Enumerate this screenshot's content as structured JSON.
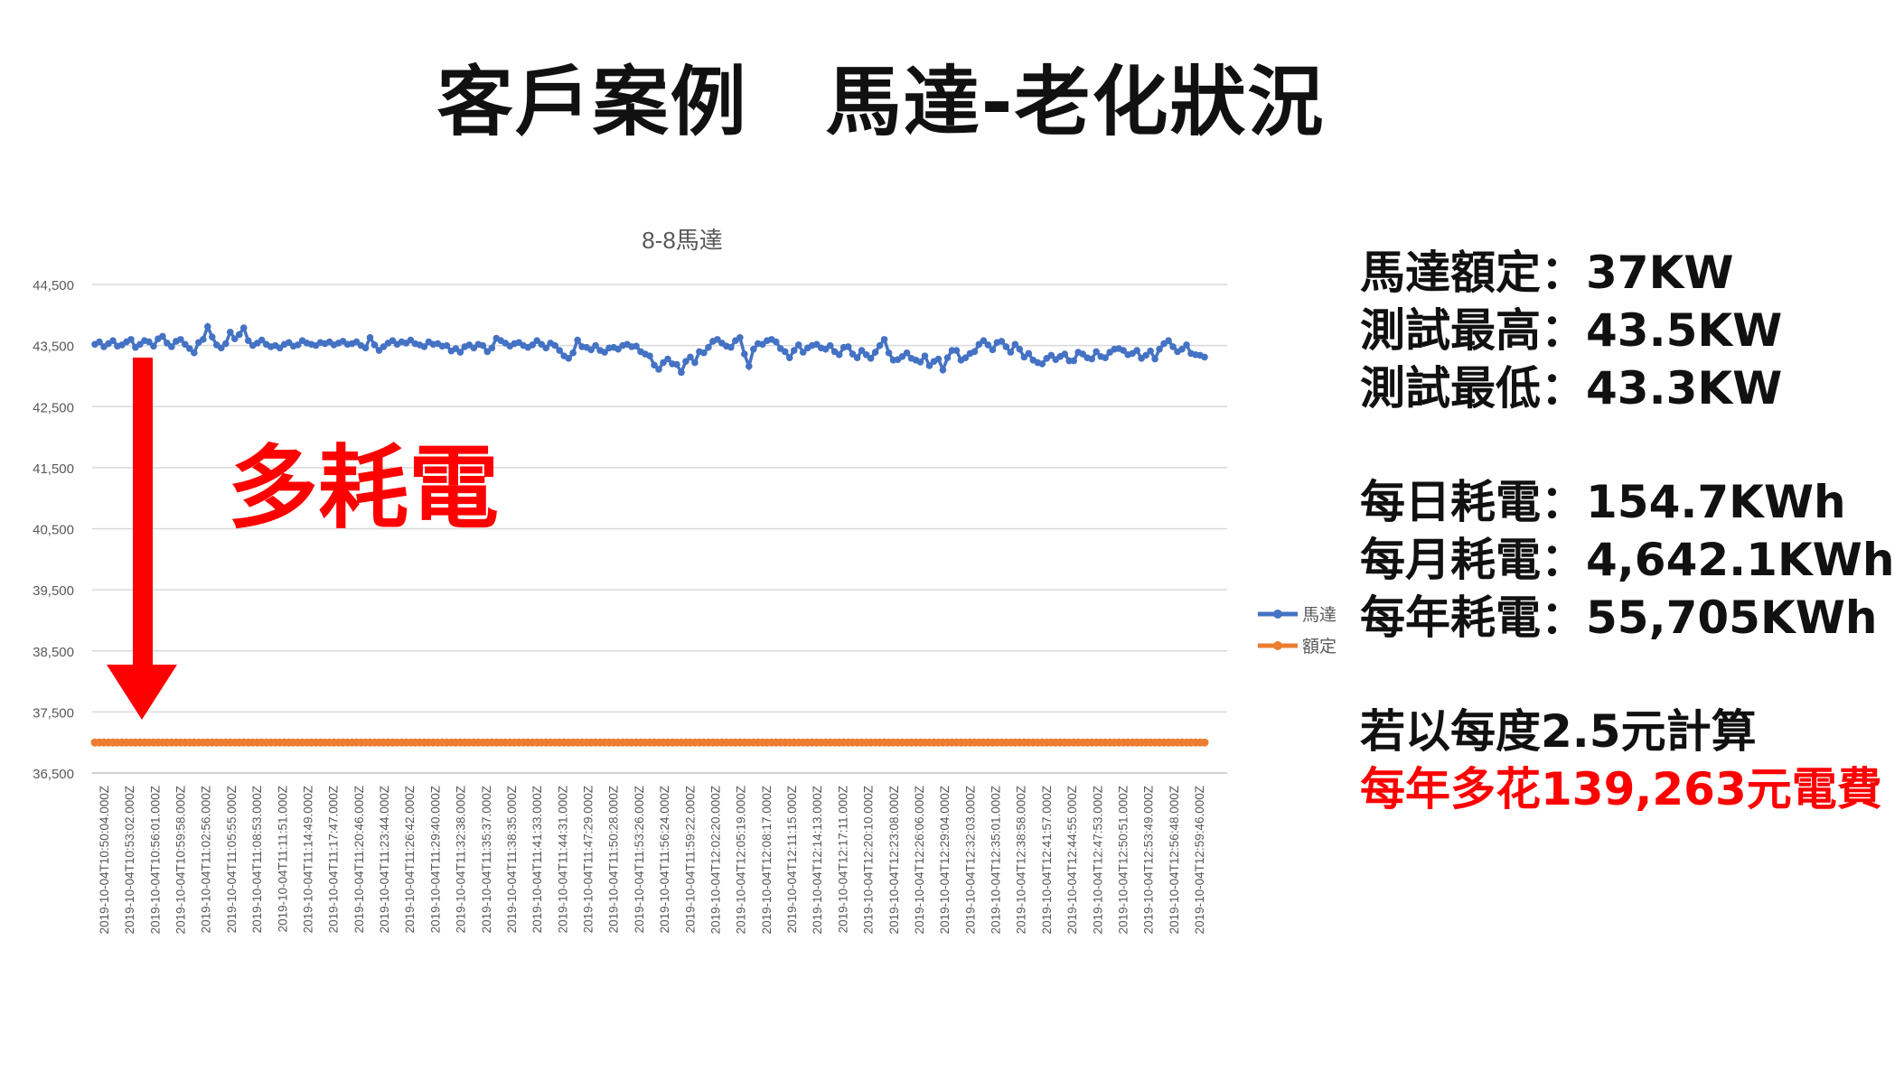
{
  "slide": {
    "title": "客戶案例　馬達-老化狀況",
    "annotation": "多耗電",
    "annotation_color": "#ff0000",
    "stats": {
      "rated": "馬達額定：37KW",
      "test_max": "測試最高：43.5KW",
      "test_min": "測試最低：43.3KW",
      "daily": "每日耗電：154.7KWh",
      "monthly": "每月耗電：4,642.1KWh",
      "yearly": "每年耗電：55,705KWh",
      "price_note": "若以每度2.5元計算",
      "extra_cost": "每年多花139,263元電費"
    }
  },
  "chart_data": {
    "type": "line",
    "title": "8-8馬達",
    "xlabel": "",
    "ylabel": "",
    "ylim": [
      36500,
      44500
    ],
    "yticks": [
      "44,500",
      "43,500",
      "42,500",
      "41,500",
      "40,500",
      "39,500",
      "38,500",
      "37,500",
      "36,500"
    ],
    "grid": true,
    "legend_position": "right",
    "x_tick_labels": [
      "2019-10-04T10:50:04.000Z",
      "2019-10-04T10:53:02.000Z",
      "2019-10-04T10:56:01.000Z",
      "2019-10-04T10:59:58.000Z",
      "2019-10-04T11:02:56.000Z",
      "2019-10-04T11:05:55.000Z",
      "2019-10-04T11:08:53.000Z",
      "2019-10-04T11:11:51.000Z",
      "2019-10-04T11:14:49.000Z",
      "2019-10-04T11:17:47.000Z",
      "2019-10-04T11:20:46.000Z",
      "2019-10-04T11:23:44.000Z",
      "2019-10-04T11:26:42.000Z",
      "2019-10-04T11:29:40.000Z",
      "2019-10-04T11:32:38.000Z",
      "2019-10-04T11:35:37.000Z",
      "2019-10-04T11:38:35.000Z",
      "2019-10-04T11:41:33.000Z",
      "2019-10-04T11:44:31.000Z",
      "2019-10-04T11:47:29.000Z",
      "2019-10-04T11:50:28.000Z",
      "2019-10-04T11:53:26.000Z",
      "2019-10-04T11:56:24.000Z",
      "2019-10-04T11:59:22.000Z",
      "2019-10-04T12:02:20.000Z",
      "2019-10-04T12:05:19.000Z",
      "2019-10-04T12:08:17.000Z",
      "2019-10-04T12:11:15.000Z",
      "2019-10-04T12:14:13.000Z",
      "2019-10-04T12:17:11.000Z",
      "2019-10-04T12:20:10.000Z",
      "2019-10-04T12:23:08.000Z",
      "2019-10-04T12:26:06.000Z",
      "2019-10-04T12:29:04.000Z",
      "2019-10-04T12:32:03.000Z",
      "2019-10-04T12:35:01.000Z",
      "2019-10-04T12:38:58.000Z",
      "2019-10-04T12:41:57.000Z",
      "2019-10-04T12:44:55.000Z",
      "2019-10-04T12:47:53.000Z",
      "2019-10-04T12:50:51.000Z",
      "2019-10-04T12:53:49.000Z",
      "2019-10-04T12:56:48.000Z",
      "2019-10-04T12:59:46.000Z"
    ],
    "series": [
      {
        "name": "馬達",
        "color": "#4472c4",
        "values": [
          43520,
          43560,
          43480,
          43530,
          43580,
          43490,
          43510,
          43560,
          43600,
          43470,
          43520,
          43580,
          43560,
          43490,
          43610,
          43650,
          43540,
          43480,
          43570,
          43600,
          43520,
          43450,
          43380,
          43550,
          43600,
          43810,
          43640,
          43510,
          43460,
          43530,
          43720,
          43610,
          43680,
          43790,
          43580,
          43500,
          43540,
          43590,
          43520,
          43480,
          43500,
          43460,
          43520,
          43550,
          43490,
          43510,
          43580,
          43540,
          43520,
          43500,
          43550,
          43530,
          43560,
          43510,
          43540,
          43570,
          43520,
          43530,
          43560,
          43500,
          43460,
          43630,
          43510,
          43420,
          43480,
          43540,
          43580,
          43520,
          43560,
          43540,
          43590,
          43530,
          43510,
          43480,
          43560,
          43520,
          43530,
          43490,
          43500,
          43410,
          43450,
          43390,
          43480,
          43510,
          43460,
          43520,
          43500,
          43400,
          43460,
          43620,
          43580,
          43540,
          43490,
          43530,
          43550,
          43500,
          43470,
          43510,
          43580,
          43520,
          43460,
          43540,
          43500,
          43420,
          43330,
          43290,
          43380,
          43590,
          43480,
          43470,
          43430,
          43500,
          43420,
          43390,
          43460,
          43470,
          43440,
          43500,
          43520,
          43480,
          43490,
          43400,
          43360,
          43330,
          43180,
          43110,
          43220,
          43280,
          43200,
          43190,
          43060,
          43240,
          43310,
          43220,
          43400,
          43380,
          43470,
          43570,
          43600,
          43540,
          43490,
          43470,
          43580,
          43630,
          43360,
          43160,
          43440,
          43530,
          43520,
          43580,
          43600,
          43560,
          43450,
          43400,
          43300,
          43420,
          43510,
          43390,
          43460,
          43500,
          43520,
          43460,
          43440,
          43500,
          43400,
          43350,
          43470,
          43480,
          43360,
          43300,
          43420,
          43350,
          43290,
          43390,
          43500,
          43600,
          43380,
          43260,
          43270,
          43320,
          43380,
          43290,
          43260,
          43230,
          43330,
          43170,
          43240,
          43280,
          43100,
          43300,
          43420,
          43420,
          43260,
          43300,
          43370,
          43400,
          43520,
          43580,
          43510,
          43430,
          43550,
          43570,
          43480,
          43390,
          43520,
          43440,
          43310,
          43370,
          43260,
          43220,
          43200,
          43290,
          43340,
          43270,
          43320,
          43360,
          43250,
          43250,
          43390,
          43360,
          43300,
          43280,
          43400,
          43320,
          43300,
          43390,
          43440,
          43450,
          43420,
          43350,
          43370,
          43420,
          43290,
          43340,
          43410,
          43280,
          43440,
          43530,
          43580,
          43480,
          43400,
          43440,
          43510,
          43370,
          43350,
          43340,
          43310
        ]
      },
      {
        "name": "額定",
        "color": "#ed7d31",
        "constant": 37000,
        "points": 247
      }
    ]
  }
}
